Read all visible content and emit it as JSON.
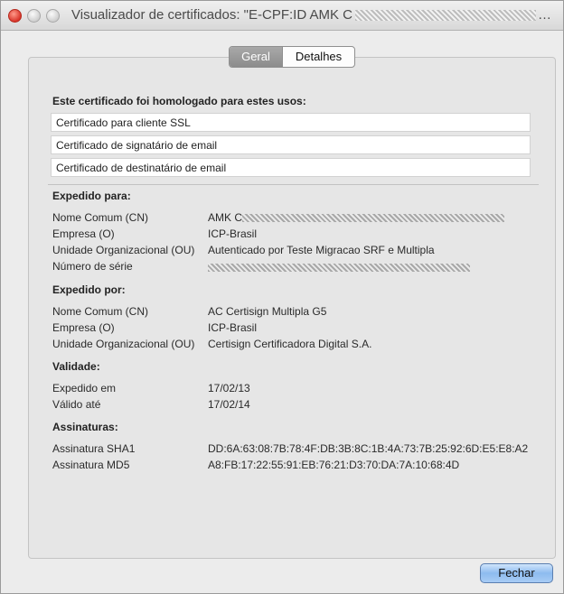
{
  "window": {
    "title_prefix": "Visualizador de certificados: \"E-CPF:ID AMK C",
    "title_ellipsis": "…"
  },
  "tabs": [
    {
      "label": "Geral",
      "active": true
    },
    {
      "label": "Detalhes",
      "active": false
    }
  ],
  "usages": {
    "heading": "Este certificado foi homologado para estes usos:",
    "items": [
      "Certificado para cliente SSL",
      "Certificado de signatário de email",
      "Certificado de destinatário de email"
    ]
  },
  "issued_to": {
    "heading": "Expedido para:",
    "rows": [
      {
        "label": "Nome Comum (CN)",
        "value": "AMK C"
      },
      {
        "label": "Empresa (O)",
        "value": "ICP-Brasil"
      },
      {
        "label": "Unidade Organizacional (OU)",
        "value": "Autenticado por Teste Migracao SRF e Multipla"
      },
      {
        "label": "Número de série",
        "value": ""
      }
    ]
  },
  "issued_by": {
    "heading": "Expedido por:",
    "rows": [
      {
        "label": "Nome Comum (CN)",
        "value": "AC Certisign Multipla G5"
      },
      {
        "label": "Empresa (O)",
        "value": "ICP-Brasil"
      },
      {
        "label": "Unidade Organizacional (OU)",
        "value": "Certisign Certificadora Digital S.A."
      }
    ]
  },
  "validity": {
    "heading": "Validade:",
    "rows": [
      {
        "label": "Expedido em",
        "value": "17/02/13"
      },
      {
        "label": "Válido até",
        "value": "17/02/14"
      }
    ]
  },
  "signatures": {
    "heading": "Assinaturas:",
    "rows": [
      {
        "label": "Assinatura SHA1",
        "value": "DD:6A:63:08:7B:78:4F:DB:3B:8C:1B:4A:73:7B:25:92:6D:E5:E8:A2"
      },
      {
        "label": "Assinatura MD5",
        "value": "A8:FB:17:22:55:91:EB:76:21:D3:70:DA:7A:10:68:4D"
      }
    ]
  },
  "footer": {
    "close_label": "Fechar"
  }
}
